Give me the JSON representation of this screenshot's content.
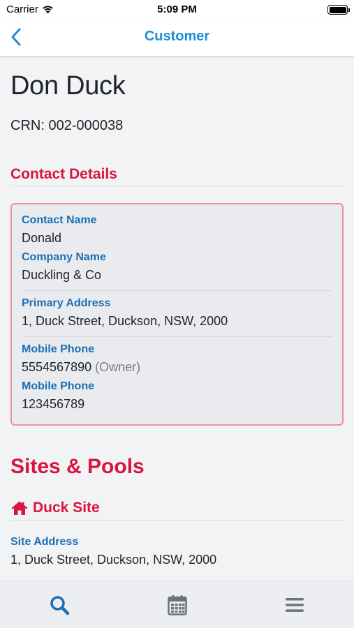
{
  "status_bar": {
    "carrier": "Carrier",
    "time": "5:09 PM"
  },
  "nav": {
    "title": "Customer"
  },
  "customer": {
    "name": "Don Duck",
    "crn": "CRN: 002-000038"
  },
  "contact_details": {
    "heading": "Contact Details",
    "contact_name_label": "Contact Name",
    "contact_name": "Donald",
    "company_name_label": "Company Name",
    "company_name": "Duckling & Co",
    "primary_address_label": "Primary Address",
    "primary_address": "1, Duck Street, Duckson, NSW, 2000",
    "phones": [
      {
        "label": "Mobile Phone",
        "number": "5554567890",
        "note": "(Owner)"
      },
      {
        "label": "Mobile Phone",
        "number": "123456789"
      }
    ]
  },
  "sites": {
    "heading": "Sites & Pools",
    "site_name": "Duck Site",
    "site_icon": "home-icon",
    "site_address_label": "Site Address",
    "site_address": "1, Duck Street, Duckson, NSW, 2000"
  },
  "tabs": [
    {
      "name": "search",
      "icon": "search-icon",
      "active": true
    },
    {
      "name": "calendar",
      "icon": "calendar-icon",
      "active": false
    },
    {
      "name": "menu",
      "icon": "menu-icon",
      "active": false
    }
  ],
  "colors": {
    "accent": "#1e8ed8",
    "section": "#d9153b",
    "label": "#1c6fb5",
    "tab_active": "#1c6fb5",
    "tab_inactive": "#6c737a"
  }
}
